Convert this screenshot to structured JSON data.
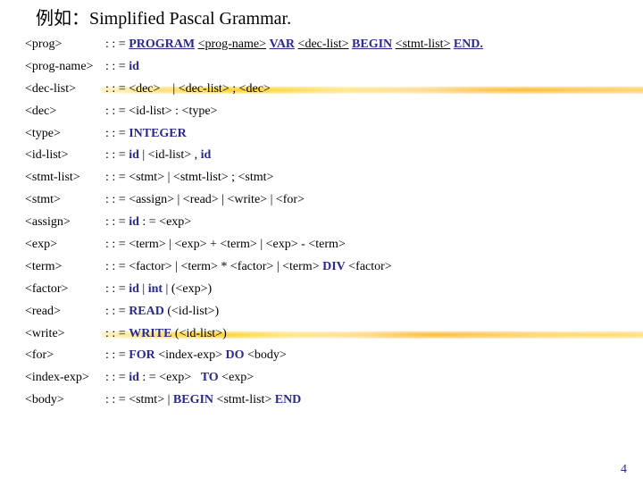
{
  "title": "例如：Simplified Pascal Grammar.",
  "pagenum": "4",
  "kw": {
    "PROGRAM": "PROGRAM",
    "VAR": "VAR",
    "BEGIN": "BEGIN",
    "END": "END.",
    "id": "id",
    "INTEGER": "INTEGER",
    "DIV": "DIV",
    "int": "int",
    "READ": "READ",
    "WRITE": "WRITE",
    "FOR": "FOR",
    "DO": "DO",
    "TO": "TO",
    "BEGIN2": "BEGIN",
    "END2": "END"
  },
  "nt": {
    "prog": "<prog>",
    "progname": "<prog-name>",
    "declist": "<dec-list>",
    "stmtlist": "<stmt-list>",
    "dec": "<dec>",
    "idlist": "<id-list>",
    "type": "<type>",
    "stmt": "<stmt>",
    "assign": "<assign>",
    "read": "<read>",
    "write": "<write>",
    "for": "<for>",
    "exp": "<exp>",
    "term": "<term>",
    "factor": "<factor>",
    "indexexp": "<index-exp>",
    "body": "<body>"
  },
  "sym": {
    "def": ": : =",
    "pipe": " | ",
    "semi": " ; ",
    "colon": " : ",
    "comma": " , ",
    "plus": " + ",
    "minus": " - ",
    "star": " * ",
    "assign": " : = ",
    "lp": "(",
    "rp": ")"
  }
}
